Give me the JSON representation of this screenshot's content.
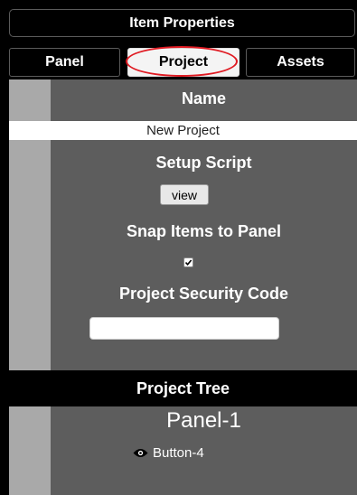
{
  "window": {
    "title": "Item Properties"
  },
  "tabs": [
    {
      "label": "Panel"
    },
    {
      "label": "Project"
    },
    {
      "label": "Assets"
    }
  ],
  "project": {
    "name_label": "Name",
    "name_value": "New Project",
    "setup_script_label": "Setup Script",
    "view_button_label": "view",
    "snap_label": "Snap Items to Panel",
    "snap_checked": true,
    "security_label": "Project Security Code",
    "security_value": ""
  },
  "tree": {
    "title": "Project Tree",
    "panel_name": "Panel-1",
    "items": [
      {
        "label": "Button-4",
        "icon": "eye-icon"
      }
    ]
  },
  "colors": {
    "highlight": "#e01a22",
    "panel_bg": "#5d5d5d",
    "strip_bg": "#a9a9a9"
  }
}
